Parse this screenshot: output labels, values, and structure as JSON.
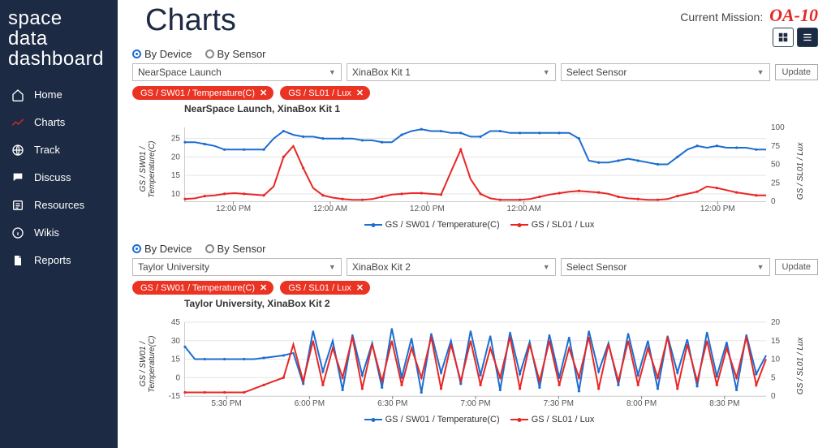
{
  "app": {
    "logo_line1": "space",
    "logo_line2": "data",
    "logo_line3": "dashboard"
  },
  "mission": {
    "label": "Current Mission:",
    "value": "OA-10"
  },
  "page_title": "Charts",
  "nav": [
    {
      "icon": "home-icon",
      "label": "Home"
    },
    {
      "icon": "charts-icon",
      "label": "Charts",
      "active": true
    },
    {
      "icon": "globe-icon",
      "label": "Track"
    },
    {
      "icon": "discuss-icon",
      "label": "Discuss"
    },
    {
      "icon": "resources-icon",
      "label": "Resources"
    },
    {
      "icon": "wikis-icon",
      "label": "Wikis"
    },
    {
      "icon": "reports-icon",
      "label": "Reports"
    }
  ],
  "blocks": [
    {
      "filter": {
        "mode_labels": [
          "By Device",
          "By Sensor"
        ],
        "mode_selected": 0,
        "selects": [
          "NearSpace Launch",
          "XinaBox Kit 1",
          "Select Sensor"
        ],
        "update_label": "Update"
      },
      "pills": [
        "GS / SW01 / Temperature(C)",
        "GS / SL01 / Lux"
      ],
      "chart_title": "NearSpace Launch, XinaBox Kit 1",
      "y_left_label": "GS / SW01 /\nTemperature(C)",
      "y_right_label": "GS / SL01 / Lux",
      "legend": [
        "GS / SW01 / Temperature(C)",
        "GS / SL01 / Lux"
      ]
    },
    {
      "filter": {
        "mode_labels": [
          "By Device",
          "By Sensor"
        ],
        "mode_selected": 0,
        "selects": [
          "Taylor University",
          "XinaBox Kit 2",
          "Select Sensor"
        ],
        "update_label": "Update"
      },
      "pills": [
        "GS / SW01 / Temperature(C)",
        "GS / SL01 / Lux"
      ],
      "chart_title": "Taylor University, XinaBox Kit 2",
      "y_left_label": "GS / SW01 /\nTemperature(C)",
      "y_right_label": "GS / SL01 / Lux",
      "legend": [
        "GS / SW01 / Temperature(C)",
        "GS / SL01 / Lux"
      ]
    }
  ],
  "chart_data": [
    {
      "type": "line",
      "title": "NearSpace Launch, XinaBox Kit 1",
      "x_ticks": [
        "12:00 PM",
        "12:00 AM",
        "12:00 PM",
        "12:00 AM",
        "",
        "12:00 PM"
      ],
      "y_left": {
        "label": "GS / SW01 / Temperature(C)",
        "ticks": [
          10,
          15,
          20,
          25
        ],
        "range": [
          8,
          28
        ]
      },
      "y_right": {
        "label": "GS / SL01 / Lux",
        "ticks": [
          0,
          25,
          50,
          75,
          100
        ],
        "range": [
          0,
          100
        ]
      },
      "series": [
        {
          "name": "GS / SW01 / Temperature(C)",
          "axis": "left",
          "color": "#1c6dd0",
          "values": [
            24,
            24,
            23.5,
            23,
            22,
            22,
            22,
            22,
            22,
            25,
            27,
            26,
            25.5,
            25.5,
            25,
            25,
            25,
            25,
            24.5,
            24.5,
            24,
            24,
            26,
            27,
            27.5,
            27,
            27,
            26.5,
            26.5,
            25.5,
            25.5,
            27,
            27,
            26.5,
            26.5,
            26.5,
            26.5,
            26.5,
            26.5,
            26.5,
            25,
            19,
            18.5,
            18.5,
            19,
            19.5,
            19,
            18.5,
            18,
            18,
            20,
            22,
            23,
            22.5,
            23,
            22.5,
            22.5,
            22.5,
            22,
            22
          ]
        },
        {
          "name": "GS / SL01 / Lux",
          "axis": "right",
          "color": "#e82725",
          "values": [
            3,
            4,
            7,
            8,
            10,
            11,
            10,
            9,
            8,
            20,
            60,
            75,
            45,
            18,
            8,
            5,
            3,
            2,
            2,
            3,
            6,
            9,
            10,
            11,
            11,
            10,
            9,
            40,
            70,
            30,
            10,
            4,
            2,
            2,
            2,
            3,
            6,
            9,
            11,
            13,
            14,
            13,
            12,
            10,
            6,
            4,
            3,
            2,
            2,
            3,
            7,
            10,
            13,
            20,
            18,
            15,
            12,
            10,
            8,
            8
          ]
        }
      ]
    },
    {
      "type": "line",
      "title": "Taylor University, XinaBox Kit 2",
      "x_ticks": [
        "5:30 PM",
        "6:00 PM",
        "6:30 PM",
        "7:00 PM",
        "7:30 PM",
        "8:00 PM",
        "8:30 PM"
      ],
      "y_left": {
        "label": "GS / SW01 / Temperature(C)",
        "ticks": [
          -15,
          0,
          15,
          30,
          45
        ],
        "range": [
          -15,
          45
        ]
      },
      "y_right": {
        "label": "GS / SL01 / Lux",
        "ticks": [
          0,
          5,
          10,
          15,
          20
        ],
        "range": [
          0,
          20
        ]
      },
      "series": [
        {
          "name": "GS / SW01 / Temperature(C)",
          "axis": "left",
          "color": "#1c6dd0",
          "values": [
            25,
            15,
            15,
            15,
            15,
            15,
            15,
            15,
            16,
            17,
            18,
            20,
            -5,
            38,
            5,
            30,
            -10,
            35,
            2,
            28,
            -8,
            40,
            0,
            32,
            -12,
            36,
            4,
            30,
            -5,
            38,
            2,
            34,
            -10,
            37,
            3,
            29,
            -8,
            35,
            0,
            33,
            -11,
            38,
            5,
            28,
            -6,
            36,
            2,
            30,
            -9,
            34,
            4,
            31,
            -7,
            37,
            1,
            29,
            -10,
            35,
            3,
            18
          ]
        },
        {
          "name": "GS / SL01 / Lux",
          "axis": "right",
          "color": "#e82725",
          "values": [
            1,
            1,
            1,
            1,
            1,
            1,
            1,
            2,
            3,
            4,
            5,
            14,
            4,
            15,
            3,
            13,
            5,
            16,
            2,
            14,
            4,
            15,
            3,
            13,
            5,
            16,
            2,
            14,
            4,
            15,
            3,
            13,
            5,
            16,
            2,
            14,
            4,
            15,
            3,
            13,
            5,
            16,
            2,
            14,
            4,
            15,
            3,
            13,
            5,
            16,
            2,
            14,
            4,
            15,
            3,
            13,
            5,
            16,
            3,
            10
          ]
        }
      ]
    }
  ]
}
